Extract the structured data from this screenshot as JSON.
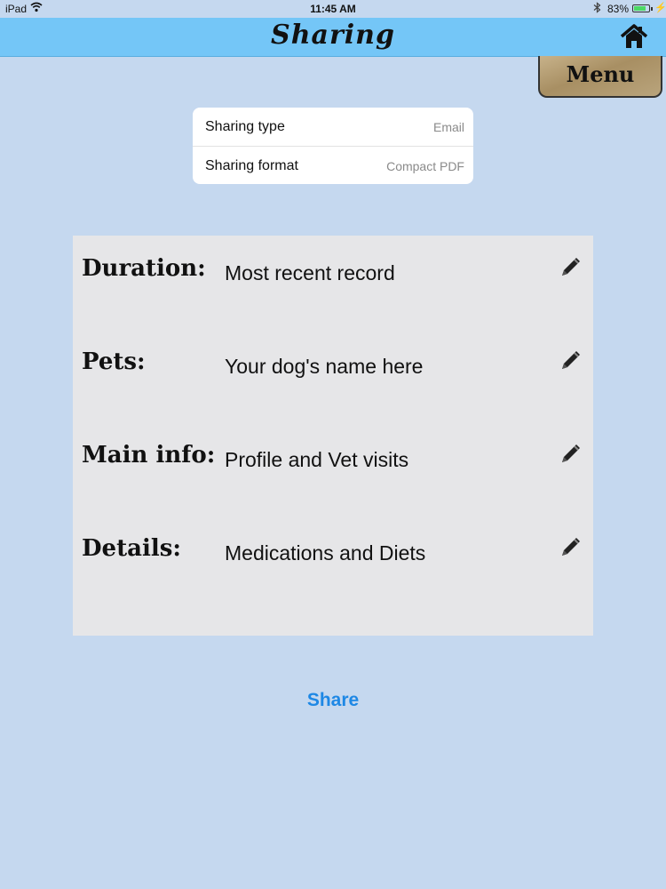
{
  "status_bar": {
    "device": "iPad",
    "time": "11:45 AM",
    "battery": "83%",
    "battery_level": 0.83
  },
  "header": {
    "title": "Sharing",
    "menu_label": "Menu"
  },
  "settings": [
    {
      "label": "Sharing type",
      "value": "Email"
    },
    {
      "label": "Sharing format",
      "value": "Compact PDF"
    }
  ],
  "records": [
    {
      "key": "Duration:",
      "value": "Most recent record"
    },
    {
      "key": "Pets:",
      "value": "Your dog's name here"
    },
    {
      "key": "Main info:",
      "value": "Profile and Vet visits"
    },
    {
      "key": "Details:",
      "value": "Medications and Diets"
    }
  ],
  "share_label": "Share",
  "colors": {
    "background": "#c5d8ef",
    "navbar": "#74c6f7",
    "accent": "#1e88e5"
  }
}
